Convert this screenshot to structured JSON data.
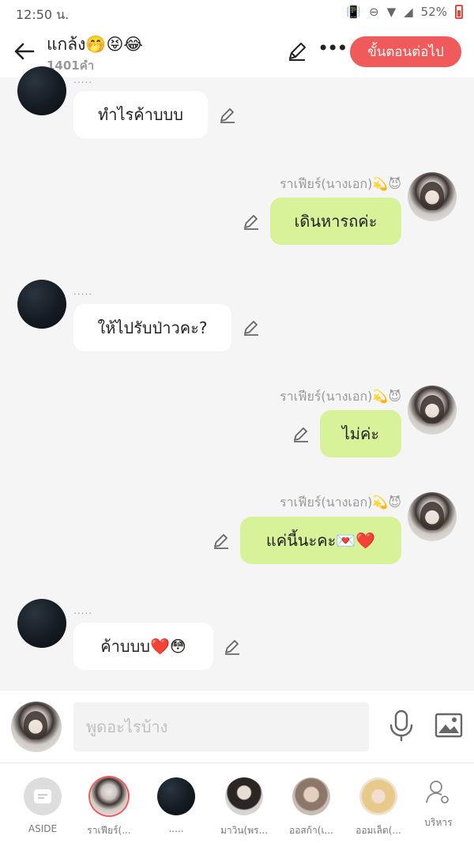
{
  "status_bar": {
    "time": "12:50 น.",
    "battery": "52%"
  },
  "header": {
    "title": "แกล้ง🤭😝😂",
    "word_count": "1401คำ",
    "next_label": "ขั้นตอนต่อไป"
  },
  "messages": [
    {
      "side": "left",
      "sender": ".....",
      "text": "ทำไรค้าบบบ"
    },
    {
      "side": "right",
      "sender": "ราเฟียร์(นางเอก)💫😈",
      "text": "เดินหารถค่ะ"
    },
    {
      "side": "left",
      "sender": ".....",
      "text": "ให้ไปรับป่าวคะ?"
    },
    {
      "side": "right",
      "sender": "ราเฟียร์(นางเอก)💫😈",
      "text": "ไม่ค่ะ"
    },
    {
      "side": "right",
      "sender": "ราเฟียร์(นางเอก)💫😈",
      "text": "แค่นี้นะคะ💌❤️"
    },
    {
      "side": "left",
      "sender": ".....",
      "text": "ค้าบบบ❤️😳"
    }
  ],
  "composer": {
    "placeholder": "พูดอะไรบ้าง"
  },
  "cast": [
    {
      "label": "ASIDE"
    },
    {
      "label": "ราเฟียร์(..."
    },
    {
      "label": "....."
    },
    {
      "label": "มาวิน(พร..."
    },
    {
      "label": "ออสก้า(เ..."
    },
    {
      "label": "ออมเล็ต(..."
    }
  ],
  "manage_label": "บริหาร",
  "colors": {
    "accent": "#f05a5a",
    "my_bubble": "#d8f29a",
    "other_bubble": "#ffffff"
  }
}
